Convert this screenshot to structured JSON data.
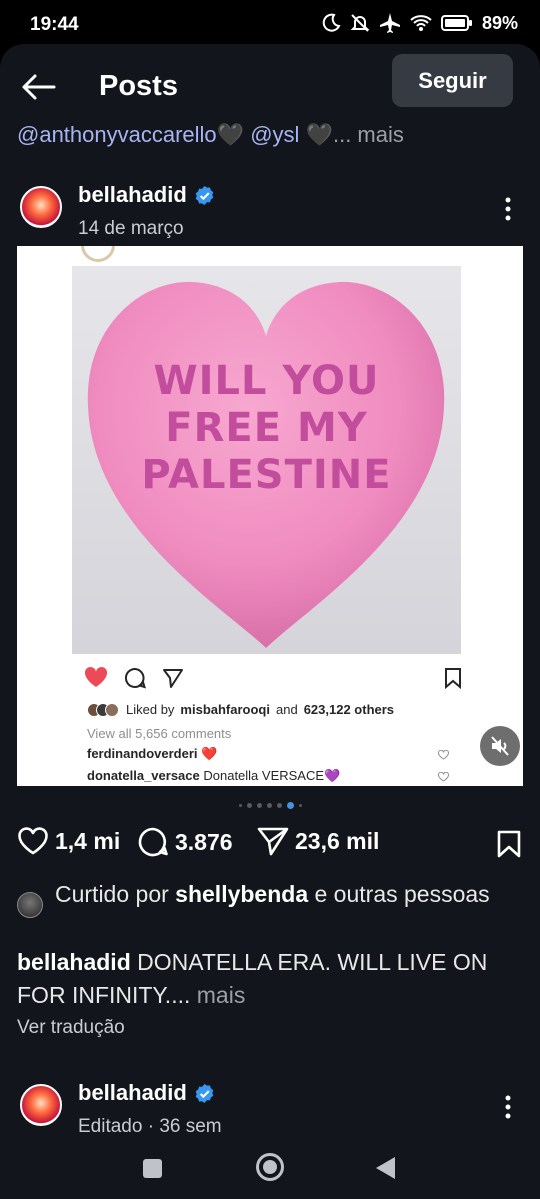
{
  "status": {
    "time": "19:44",
    "battery": "89%"
  },
  "topbar": {
    "title": "Posts",
    "follow_label": "Seguir"
  },
  "prev_caption": {
    "mention1": "@anthonyvaccarello",
    "heart1": "🖤",
    "mention2": "@ysl",
    "heart2": "🖤",
    "more": "... mais"
  },
  "post": {
    "username": "bellahadid",
    "date": "14 de março",
    "image": {
      "heart_text": [
        "WILL YOU",
        "FREE MY",
        "PALESTINE"
      ],
      "liked_prefix": "Liked by",
      "liked_user": "misbahfarooqi",
      "liked_and": "and",
      "liked_count": "623,122 others",
      "view_all": "View all 5,656 comments",
      "comment1_user": "ferdinandoverderi",
      "comment1_text": "❤️",
      "comment2_user": "donatella_versace",
      "comment2_text": "Donatella VERSACE💜"
    },
    "carousel": {
      "count": 7,
      "active": 5
    },
    "likes": "1,4 mi",
    "comments": "3.876",
    "shares": "23,6 mil",
    "liked_by": {
      "prefix": "Curtido por",
      "user": "shellybenda",
      "suffix": "e outras pessoas"
    },
    "caption": {
      "user": "bellahadid",
      "text": "DONATELLA ERA. WILL LIVE ON FOR INFINITY....",
      "more": "mais"
    },
    "translate": "Ver tradução"
  },
  "post2": {
    "username": "bellahadid",
    "meta": "Editado · 36 sem"
  },
  "colors": {
    "accent": "#4a90e2",
    "mention": "#a7b4f2",
    "background": "#12151b",
    "like_red": "#ed4956"
  }
}
